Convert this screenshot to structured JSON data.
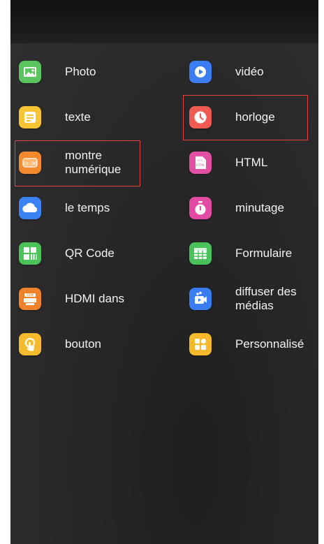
{
  "apps_left": [
    {
      "label": "Photo",
      "icon": "photo-icon",
      "color": "#5ac45f"
    },
    {
      "label": "texte",
      "icon": "text-icon",
      "color": "#f7c434"
    },
    {
      "label": "montre\nnumérique",
      "icon": "digital-clock-icon",
      "color": "#f28a2d"
    },
    {
      "label": "le temps",
      "icon": "weather-icon",
      "color": "#3b82f2"
    },
    {
      "label": "QR Code",
      "icon": "qr-code-icon",
      "color": "#4cc25a"
    },
    {
      "label": "HDMI dans",
      "icon": "hdmi-icon",
      "color": "#f2812b"
    },
    {
      "label": "bouton",
      "icon": "button-icon",
      "color": "#f5bb2e"
    }
  ],
  "apps_right": [
    {
      "label": "vidéo",
      "icon": "video-icon",
      "color": "#3b7df2"
    },
    {
      "label": "horloge",
      "icon": "clock-icon",
      "color": "#ef5b52"
    },
    {
      "label": "HTML",
      "icon": "html-icon",
      "color": "#e34fa3"
    },
    {
      "label": "minutage",
      "icon": "timer-icon",
      "color": "#e24aa3"
    },
    {
      "label": "Formulaire",
      "icon": "table-icon",
      "color": "#48c259"
    },
    {
      "label": "diffuser des\nmédias",
      "icon": "media-stream-icon",
      "color": "#3a7df2"
    },
    {
      "label": "Personnalisé",
      "icon": "custom-icon",
      "color": "#f5b92c"
    }
  ],
  "highlight_color": "#e0443e"
}
